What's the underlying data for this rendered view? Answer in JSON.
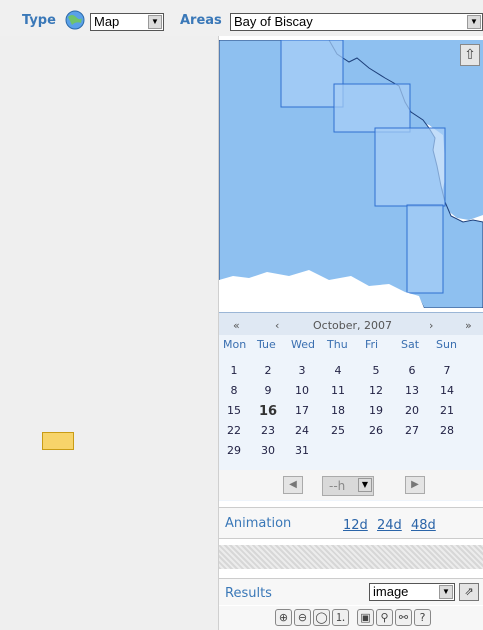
{
  "toolbar": {
    "type_label": "Type",
    "type_icon": "globe-icon",
    "type_value": "Map",
    "areas_label": "Areas",
    "area_value": "Bay of Biscay"
  },
  "map": {
    "up_icon": "arrow-up-icon",
    "land_color": "#ffffff",
    "sea_color": "#8ec0f0",
    "box_color": "#2f6fd0"
  },
  "calendar": {
    "prev_year": "«",
    "prev_month": "‹",
    "month_label": "October, 2007",
    "next_month": "›",
    "next_year": "»",
    "weekdays": [
      "Mon",
      "Tue",
      "Wed",
      "Thu",
      "Fri",
      "Sat",
      "Sun"
    ],
    "weeks": [
      [
        "1",
        "2",
        "3",
        "4",
        "5",
        "6",
        "7"
      ],
      [
        "8",
        "9",
        "10",
        "11",
        "12",
        "13",
        "14"
      ],
      [
        "15",
        "16",
        "17",
        "18",
        "19",
        "20",
        "21"
      ],
      [
        "22",
        "23",
        "24",
        "25",
        "26",
        "27",
        "28"
      ],
      [
        "29",
        "30",
        "31",
        "",
        "",
        "",
        ""
      ]
    ],
    "selected_day": "16",
    "hour_value": "--h"
  },
  "animation": {
    "label": "Animation",
    "links": [
      "12d",
      "24d",
      "48d"
    ]
  },
  "results": {
    "label": "Results",
    "format_value": "image",
    "export_icon": "export-icon",
    "tools": [
      "zoom-in-icon",
      "zoom-out-icon",
      "zoom-extent-icon",
      "zoom-1-1-icon",
      "save-icon",
      "link-icon",
      "unlink-icon",
      "help-icon"
    ],
    "tool_glyphs": [
      "⊕",
      "⊖",
      "◯",
      "⒈",
      "▣",
      "⚲",
      "⚯",
      "?"
    ]
  }
}
